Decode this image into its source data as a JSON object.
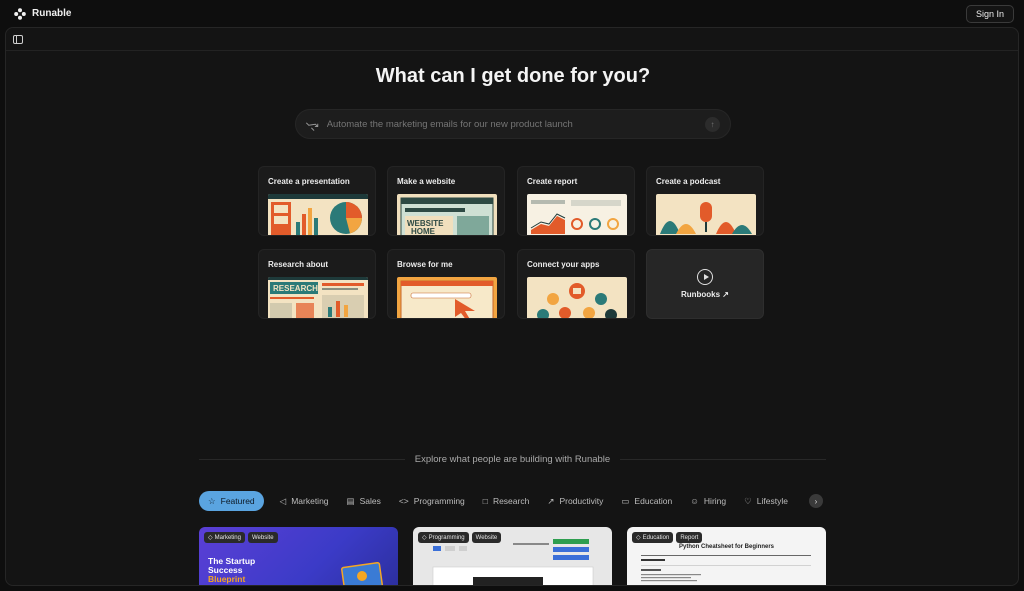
{
  "brand": {
    "name": "Runable"
  },
  "header": {
    "sign_in": "Sign In"
  },
  "hero": {
    "title": "What can I get done for you?"
  },
  "prompt": {
    "placeholder": "Automate the marketing emails for our new product launch"
  },
  "cards": [
    {
      "label": "Create a presentation",
      "art": "presentation"
    },
    {
      "label": "Make a website",
      "art": "website",
      "art_text": "WEBSITE HOME"
    },
    {
      "label": "Create report",
      "art": "report"
    },
    {
      "label": "Create a podcast",
      "art": "podcast"
    },
    {
      "label": "Research about",
      "art": "research",
      "art_text": "RESEARCH"
    },
    {
      "label": "Browse for me",
      "art": "browse"
    },
    {
      "label": "Connect your apps",
      "art": "apps"
    },
    {
      "label": "Runbooks ↗",
      "art": "runbooks"
    }
  ],
  "explore": {
    "text": "Explore what people are building with Runable"
  },
  "tabs": [
    {
      "label": "Featured",
      "icon": "star-icon",
      "active": true
    },
    {
      "label": "Marketing",
      "icon": "megaphone-icon"
    },
    {
      "label": "Sales",
      "icon": "chart-icon"
    },
    {
      "label": "Programming",
      "icon": "code-icon"
    },
    {
      "label": "Research",
      "icon": "book-icon"
    },
    {
      "label": "Productivity",
      "icon": "trend-icon"
    },
    {
      "label": "Education",
      "icon": "book-open-icon"
    },
    {
      "label": "Hiring",
      "icon": "people-icon"
    },
    {
      "label": "Lifestyle",
      "icon": "heart-icon"
    }
  ],
  "showcase": [
    {
      "tags": [
        "Marketing",
        "Website"
      ],
      "title_line1": "The Startup",
      "title_line2": "Success",
      "title_highlight": "Blueprint"
    },
    {
      "tags": [
        "Programming",
        "Website"
      ]
    },
    {
      "tags": [
        "Education",
        "Report"
      ],
      "title": "Python Cheatsheet for Beginners"
    }
  ],
  "colors": {
    "accent": "#5aa4e0",
    "background": "#0e0e0e",
    "panel": "#141414"
  }
}
